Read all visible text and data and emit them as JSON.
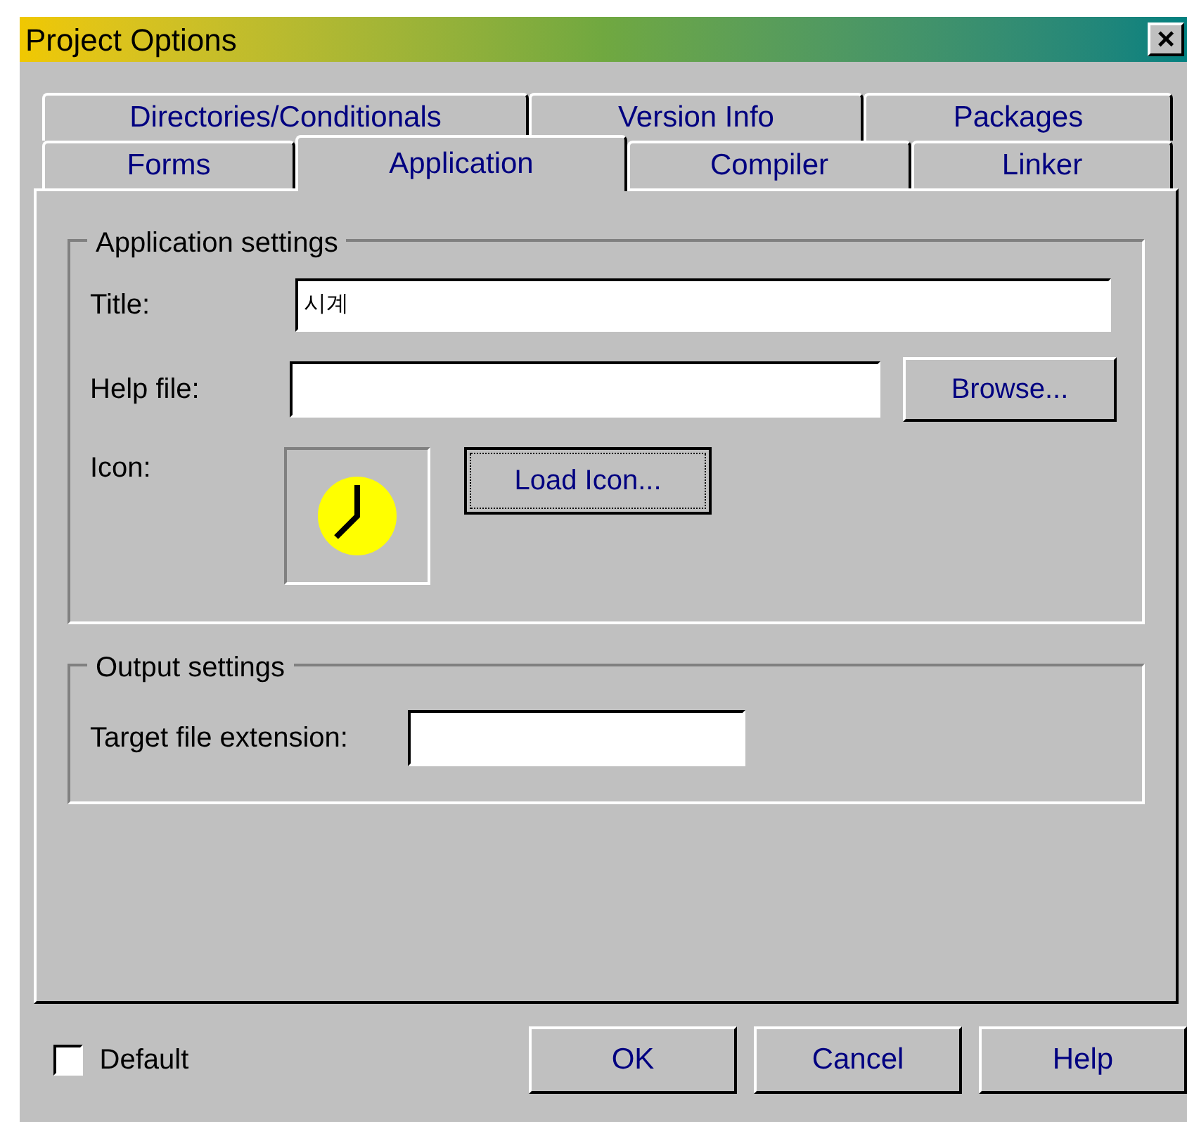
{
  "window": {
    "title": "Project Options",
    "close_label": "×"
  },
  "tab_rows": [
    [
      {
        "label": "Directories/Conditionals",
        "selected": false
      },
      {
        "label": "Version Info",
        "selected": false
      },
      {
        "label": "Packages",
        "selected": false
      }
    ],
    [
      {
        "label": "Forms",
        "selected": false
      },
      {
        "label": "Application",
        "selected": true
      },
      {
        "label": "Compiler",
        "selected": false
      },
      {
        "label": "Linker",
        "selected": false
      }
    ]
  ],
  "application_settings": {
    "title": "Application settings",
    "title_label": "Title:",
    "title_value": "시계",
    "help_file_label": "Help file:",
    "browse_button": "Browse...",
    "icon_label": "Icon:",
    "load_icon_button": "Load Icon..."
  },
  "output_settings": {
    "title": "Output settings",
    "extension_label": "Target file extension:"
  },
  "default_checkbox": {
    "label": "Default",
    "checked": false
  },
  "buttons": [
    "OK",
    "Cancel",
    "Help"
  ]
}
